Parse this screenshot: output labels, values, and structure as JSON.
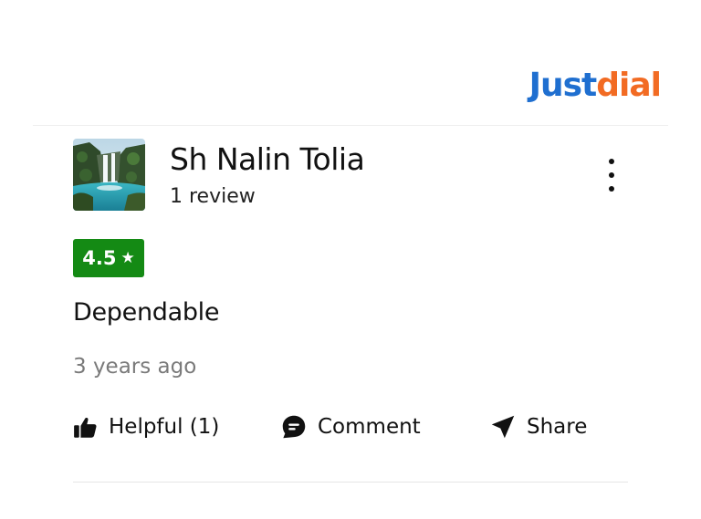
{
  "brand": {
    "name_part1": "Just",
    "name_part2": "dial",
    "color_blue": "#1f6fd0",
    "color_orange": "#f26b23"
  },
  "review": {
    "reviewer_name": "Sh Nalin Tolia",
    "review_count": "1 review",
    "avatar_icon": "waterfall-landscape-photo",
    "rating": "4.5",
    "rating_star": "★",
    "rating_color": "#148a14",
    "text": "Dependable",
    "timestamp": "3 years ago",
    "menu_icon": "more-vertical-icon"
  },
  "actions": {
    "helpful": {
      "label": "Helpful (1)",
      "icon": "thumbs-up-icon"
    },
    "comment": {
      "label": "Comment",
      "icon": "comment-icon"
    },
    "share": {
      "label": "Share",
      "icon": "send-icon"
    }
  }
}
